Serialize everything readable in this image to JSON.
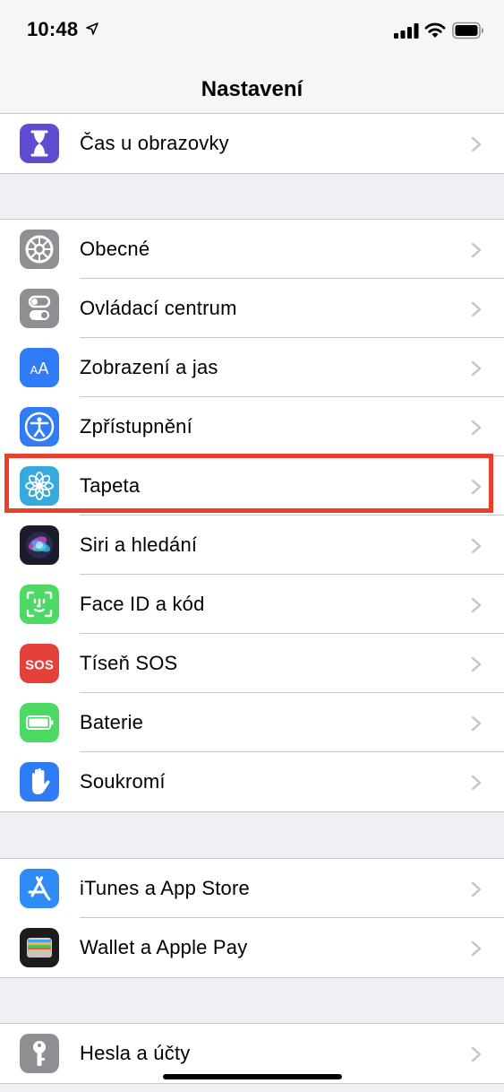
{
  "status_bar": {
    "time": "10:48"
  },
  "nav": {
    "title": "Nastavení"
  },
  "groups": [
    {
      "items": [
        {
          "label": "Čas u obrazovky",
          "icon": "hourglass-icon",
          "color": "#5e4ccf"
        }
      ]
    },
    {
      "items": [
        {
          "label": "Obecné",
          "icon": "gear-icon",
          "color": "#8e8e93"
        },
        {
          "label": "Ovládací centrum",
          "icon": "toggles-icon",
          "color": "#8e8e93"
        },
        {
          "label": "Zobrazení a jas",
          "icon": "text-size-icon",
          "color": "#2f7cf6"
        },
        {
          "label": "Zpřístupnění",
          "icon": "accessibility-icon",
          "color": "#2f7cf6"
        },
        {
          "label": "Tapeta",
          "icon": "flower-icon",
          "color": "#36aadc"
        },
        {
          "label": "Siri a hledání",
          "icon": "siri-icon",
          "color": "#1b1b2e"
        },
        {
          "label": "Face ID a kód",
          "icon": "face-id-icon",
          "color": "#4cd964"
        },
        {
          "label": "Tíseň SOS",
          "icon": "sos-icon",
          "color": "#e5403a",
          "icon_text": "SOS"
        },
        {
          "label": "Baterie",
          "icon": "battery-icon",
          "color": "#4cd964"
        },
        {
          "label": "Soukromí",
          "icon": "hand-icon",
          "color": "#2f7cf6"
        }
      ]
    },
    {
      "items": [
        {
          "label": "iTunes a App Store",
          "icon": "app-store-icon",
          "color": "#2f8cf6"
        },
        {
          "label": "Wallet a Apple Pay",
          "icon": "wallet-icon",
          "color": "#1c1c1e"
        }
      ]
    },
    {
      "items": [
        {
          "label": "Hesla a účty",
          "icon": "key-icon",
          "color": "#8e8e93"
        }
      ]
    }
  ],
  "highlight_color": "#e8402c"
}
